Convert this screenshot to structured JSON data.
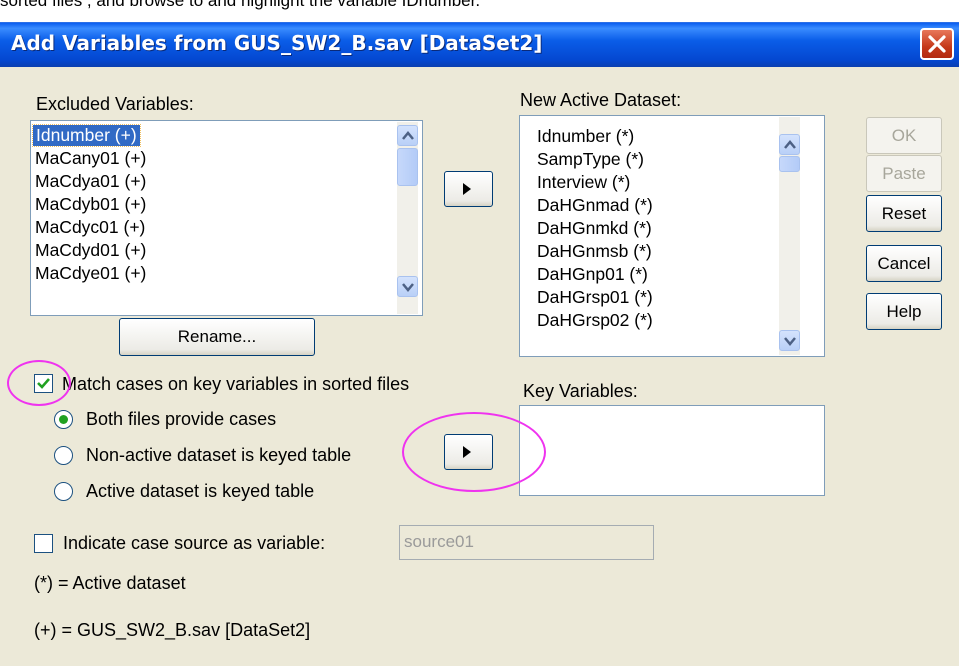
{
  "caption_text": "sorted files , and browse to and highlight the variable IDnumber.",
  "window": {
    "title": "Add Variables from GUS_SW2_B.sav [DataSet2]"
  },
  "excluded": {
    "label": "Excluded Variables:",
    "items": [
      "Idnumber (+)",
      "MaCany01 (+)",
      "MaCdya01 (+)",
      "MaCdyb01 (+)",
      "MaCdyc01 (+)",
      "MaCdyd01 (+)",
      "MaCdye01 (+)"
    ],
    "selected_index": 0
  },
  "rename_label": "Rename...",
  "active": {
    "label": "New Active Dataset:",
    "items": [
      "Idnumber (*)",
      "SampType (*)",
      "Interview (*)",
      "DaHGnmad (*)",
      "DaHGnmkd (*)",
      "DaHGnmsb (*)",
      "DaHGnp01 (*)",
      "DaHGrsp01 (*)",
      "DaHGrsp02 (*)"
    ]
  },
  "buttons": {
    "ok": "OK",
    "paste": "Paste",
    "reset": "Reset",
    "cancel": "Cancel",
    "help": "Help"
  },
  "match": {
    "label": "Match cases on key variables in sorted files",
    "checked": true
  },
  "radios": [
    {
      "label": "Both files provide cases",
      "selected": true
    },
    {
      "label": "Non-active dataset is keyed table",
      "selected": false
    },
    {
      "label": "Active dataset is keyed table",
      "selected": false
    }
  ],
  "key_variables": {
    "label": "Key Variables:"
  },
  "indicate": {
    "label": "Indicate case source as variable:",
    "value": "source01",
    "checked": false
  },
  "legend": {
    "active": "(*) = Active dataset",
    "other": "(+) = GUS_SW2_B.sav [DataSet2]"
  },
  "colors": {
    "titlebar": "#0a5ee8",
    "selection": "#316ac5",
    "annotation": "#ef33ef",
    "dialog_bg": "#ece9d8"
  },
  "icons": {
    "move_right": "right-triangle-icon",
    "close": "close-x-icon",
    "scroll_up": "chevron-up-icon",
    "scroll_down": "chevron-down-icon",
    "check": "check-icon"
  }
}
